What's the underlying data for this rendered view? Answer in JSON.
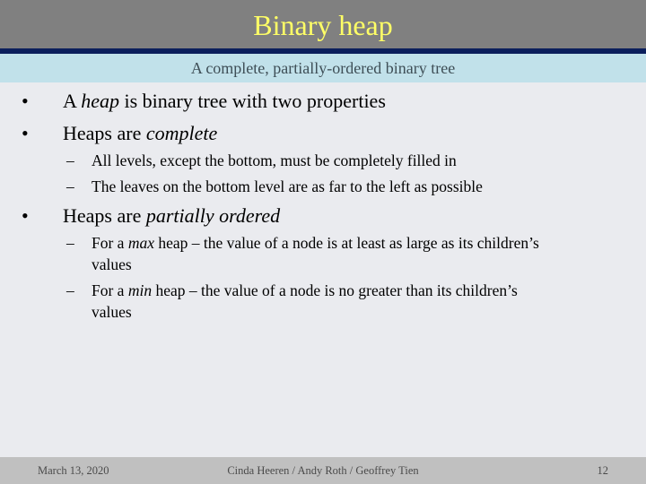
{
  "slide": {
    "title": "Binary heap",
    "subtitle": "A complete, partially-ordered binary tree",
    "colors": {
      "title_bar": "#808080",
      "title_text": "#ffff66",
      "title_rule": "#0b1f5c",
      "subtitle_band": "#c1e1ea",
      "background": "#eaebef",
      "footer_band": "#c0c0c0"
    },
    "bullets": [
      {
        "marker": "•",
        "pre": "A ",
        "em": "heap",
        "post": " is binary tree with two properties"
      },
      {
        "marker": "•",
        "pre": "Heaps are ",
        "em": "complete",
        "post": ""
      },
      {
        "marker": "•",
        "pre": "Heaps are ",
        "em": "partially ordered",
        "post": ""
      }
    ],
    "sub_bullets": [
      {
        "marker": "–",
        "line1": "All levels, except the bottom, must be completely filled in"
      },
      {
        "marker": "–",
        "line1": "The leaves on the bottom level are as far to the left as possible"
      },
      {
        "marker": "–",
        "pre": "For a ",
        "em": "max",
        "post": " heap – the value of a node is at least as large as its children’s",
        "line2": "values"
      },
      {
        "marker": "–",
        "pre": "For a ",
        "em": "min",
        "post": " heap – the value of a node is no greater than its children’s",
        "line2": "values"
      }
    ],
    "footer": {
      "date": "March 13, 2020",
      "authors": "Cinda Heeren / Andy Roth / Geoffrey Tien",
      "page_number": "12"
    }
  }
}
